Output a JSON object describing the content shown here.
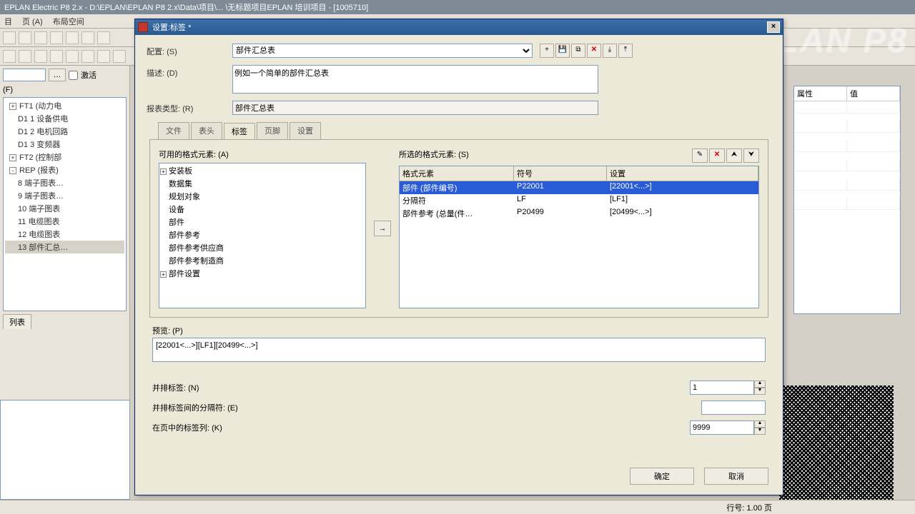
{
  "app": {
    "title": "EPLAN Electric P8 2.x - D:\\EPLAN\\EPLAN P8 2.x\\Data\\项目\\... \\无标题项目EPLAN 培训项目 - [1005710]",
    "menubar": [
      "目",
      "页 (A)",
      "布局空间"
    ],
    "status": "行号: 1.00  页"
  },
  "leftpane": {
    "checkbox": "激活",
    "filter_label": "(F)",
    "tab": "列表",
    "tree": [
      {
        "lvl": 0,
        "exp": "+",
        "txt": "FT1 (动力电"
      },
      {
        "lvl": 1,
        "exp": "",
        "txt": "D1 1 设备供电"
      },
      {
        "lvl": 1,
        "exp": "",
        "txt": "D1 2 电机回路"
      },
      {
        "lvl": 1,
        "exp": "",
        "txt": "D1 3 变频器"
      },
      {
        "lvl": 0,
        "exp": "+",
        "txt": "FT2 (控制部"
      },
      {
        "lvl": 0,
        "exp": "-",
        "txt": "REP (报表)"
      },
      {
        "lvl": 1,
        "exp": "",
        "txt": "8 端子图表…"
      },
      {
        "lvl": 1,
        "exp": "",
        "txt": "9 端子图表…"
      },
      {
        "lvl": 1,
        "exp": "",
        "txt": "10 端子图表"
      },
      {
        "lvl": 1,
        "exp": "",
        "txt": "11 电缆图表"
      },
      {
        "lvl": 1,
        "exp": "",
        "txt": "12 电缆图表"
      },
      {
        "lvl": 1,
        "exp": "",
        "txt": "13 部件汇总…",
        "sel": true
      }
    ]
  },
  "dialog": {
    "title": "设置:标签 *",
    "labels": {
      "config": "配置: (S)",
      "desc": "描述: (D)",
      "type": "报表类型: (R)",
      "avail": "可用的格式元素: (A)",
      "selected": "所选的格式元素: (S)",
      "preview": "预览: (P)",
      "f1": "并排标签: (N)",
      "f2": "并排标签间的分隔符: (E)",
      "f3": "在页中的标签列: (K)"
    },
    "config_value": "部件汇总表",
    "desc_value": "例如一个简单的部件汇总表",
    "type_value": "部件汇总表",
    "tabs": [
      "文件",
      "表头",
      "标签",
      "页脚",
      "设置"
    ],
    "active_tab": 2,
    "avail_list": [
      {
        "exp": "+",
        "txt": "安装板"
      },
      {
        "exp": "",
        "txt": "数据集"
      },
      {
        "exp": "",
        "txt": "规划对象"
      },
      {
        "exp": "",
        "txt": "设备"
      },
      {
        "exp": "",
        "txt": "部件"
      },
      {
        "exp": "",
        "txt": "部件参考"
      },
      {
        "exp": "",
        "txt": "部件参考供应商"
      },
      {
        "exp": "",
        "txt": "部件参考制造商"
      },
      {
        "exp": "+",
        "txt": "部件设置"
      }
    ],
    "sel_headers": [
      "格式元素",
      "符号",
      "设置"
    ],
    "sel_rows": [
      {
        "c1": "部件 (部件编号)",
        "c2": "P22001",
        "c3": "[22001<...>]",
        "sel": true
      },
      {
        "c1": "分隔符",
        "c2": "LF",
        "c3": "[LF1]"
      },
      {
        "c1": "部件参考 (总量(件…",
        "c2": "P20499",
        "c3": "[20499<...>]"
      }
    ],
    "preview_value": "[22001<...>][LF1][20499<...>]",
    "f1_value": "1",
    "f2_value": "",
    "f3_value": "9999",
    "ok": "确定",
    "cancel": "取消"
  },
  "rightgrid": {
    "h1": "属性",
    "h2": "值",
    "rows": [
      "",
      "",
      "",
      "",
      "",
      "",
      ""
    ]
  }
}
